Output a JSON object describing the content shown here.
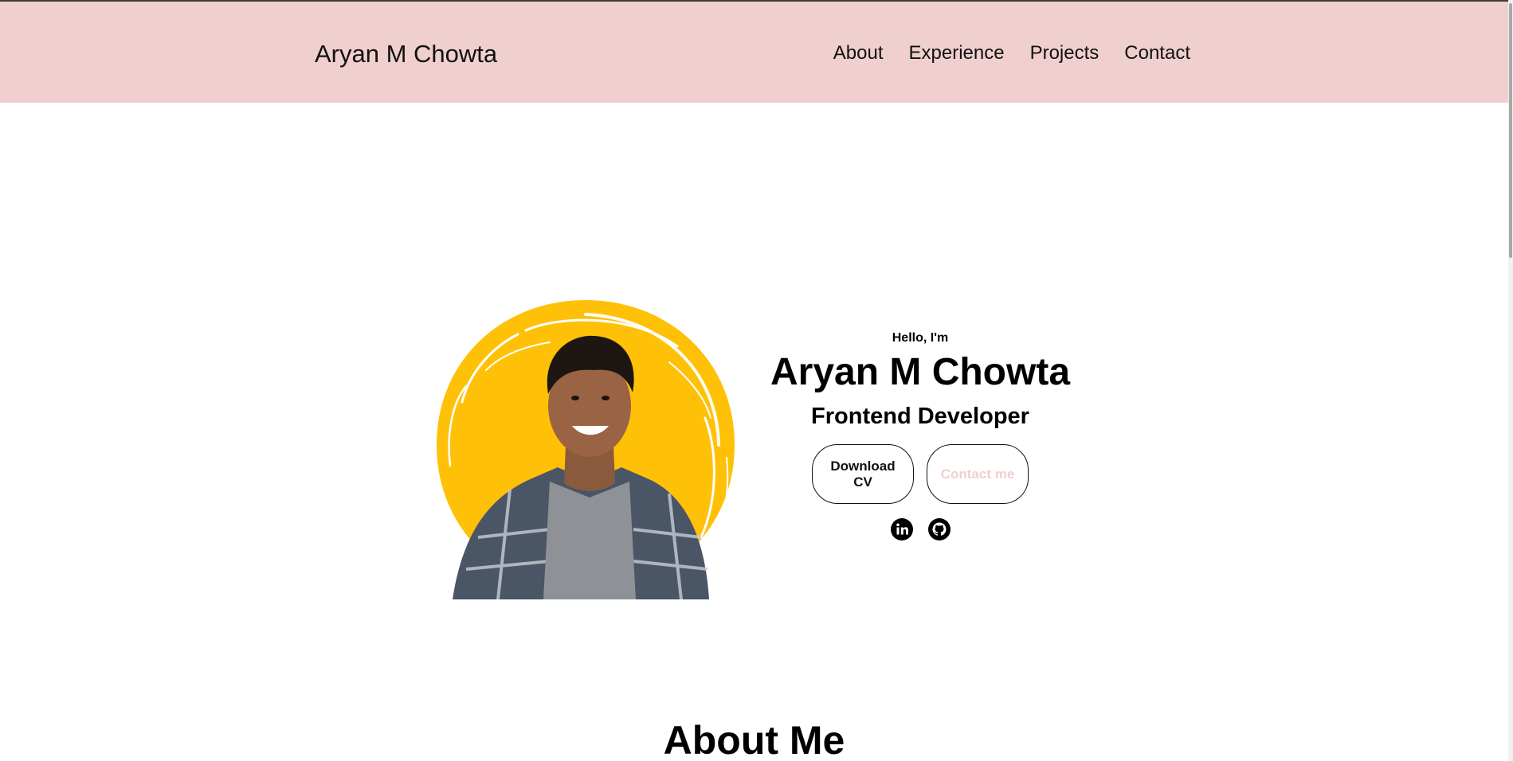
{
  "nav": {
    "logo": "Aryan M Chowta",
    "links": [
      "About",
      "Experience",
      "Projects",
      "Contact"
    ]
  },
  "hero": {
    "greeting": "Hello, I'm",
    "name": "Aryan M Chowta",
    "role": "Frontend Developer",
    "buttons": {
      "download_cv": "Download CV",
      "contact": "Contact me"
    },
    "social": {
      "linkedin_icon": "linkedin-icon",
      "github_icon": "github-icon"
    }
  },
  "about": {
    "title": "About Me"
  },
  "colors": {
    "nav_background": "#f0cfcf",
    "accent_circle": "#ffc107",
    "contact_text": "#f0cfcf"
  }
}
